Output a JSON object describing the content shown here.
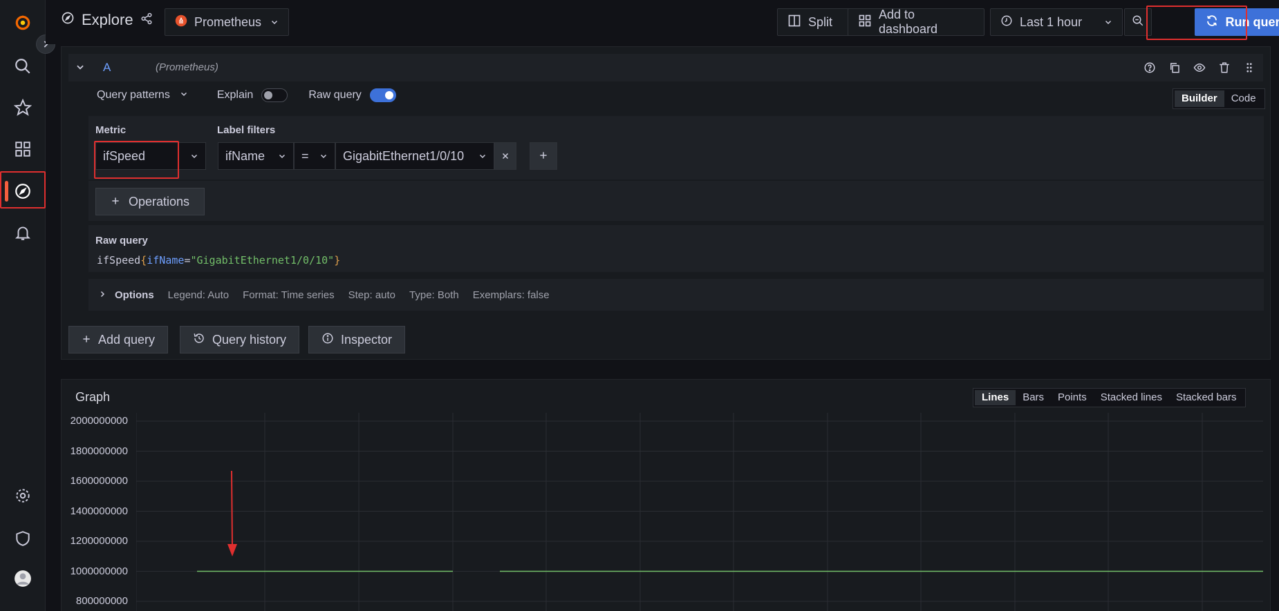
{
  "header": {
    "title": "Explore",
    "datasource": "Prometheus",
    "split_label": "Split",
    "add_dashboard_label": "Add to dashboard",
    "time_range": "Last 1 hour",
    "run_query_label": "Run query"
  },
  "query": {
    "letter": "A",
    "datasource": "(Prometheus)",
    "patterns_label": "Query patterns",
    "explain_label": "Explain",
    "raw_query_label": "Raw query",
    "mode_builder": "Builder",
    "mode_code": "Code",
    "metric_label": "Metric",
    "metric_value": "ifSpeed",
    "label_filters_label": "Label filters",
    "filter_label": "ifName",
    "filter_op": "=",
    "filter_value": "GigabitEthernet1/0/10",
    "operations_label": "Operations",
    "raw_title": "Raw query",
    "raw": {
      "metric": "ifSpeed",
      "open": "{",
      "key": "ifName",
      "eq": "=",
      "value": "\"GigabitEthernet1/0/10\"",
      "close": "}"
    },
    "options": {
      "title": "Options",
      "legend": "Legend: Auto",
      "format": "Format: Time series",
      "step": "Step: auto",
      "type": "Type: Both",
      "exemplars": "Exemplars: false"
    }
  },
  "actions": {
    "add_query": "Add query",
    "history": "Query history",
    "inspector": "Inspector"
  },
  "graph": {
    "title": "Graph",
    "types": [
      "Lines",
      "Bars",
      "Points",
      "Stacked lines",
      "Stacked bars"
    ],
    "active_type": "Lines",
    "line_color": "#73bf69"
  },
  "chart_data": {
    "type": "line",
    "title": "Graph",
    "y_ticks": [
      "2000000000",
      "1800000000",
      "1600000000",
      "1400000000",
      "1200000000",
      "1000000000",
      "800000000"
    ],
    "ylim": [
      800000000,
      2000000000
    ],
    "series": [
      {
        "values": [
          1000000000,
          1000000000
        ],
        "gap": true
      }
    ],
    "grid": true
  }
}
